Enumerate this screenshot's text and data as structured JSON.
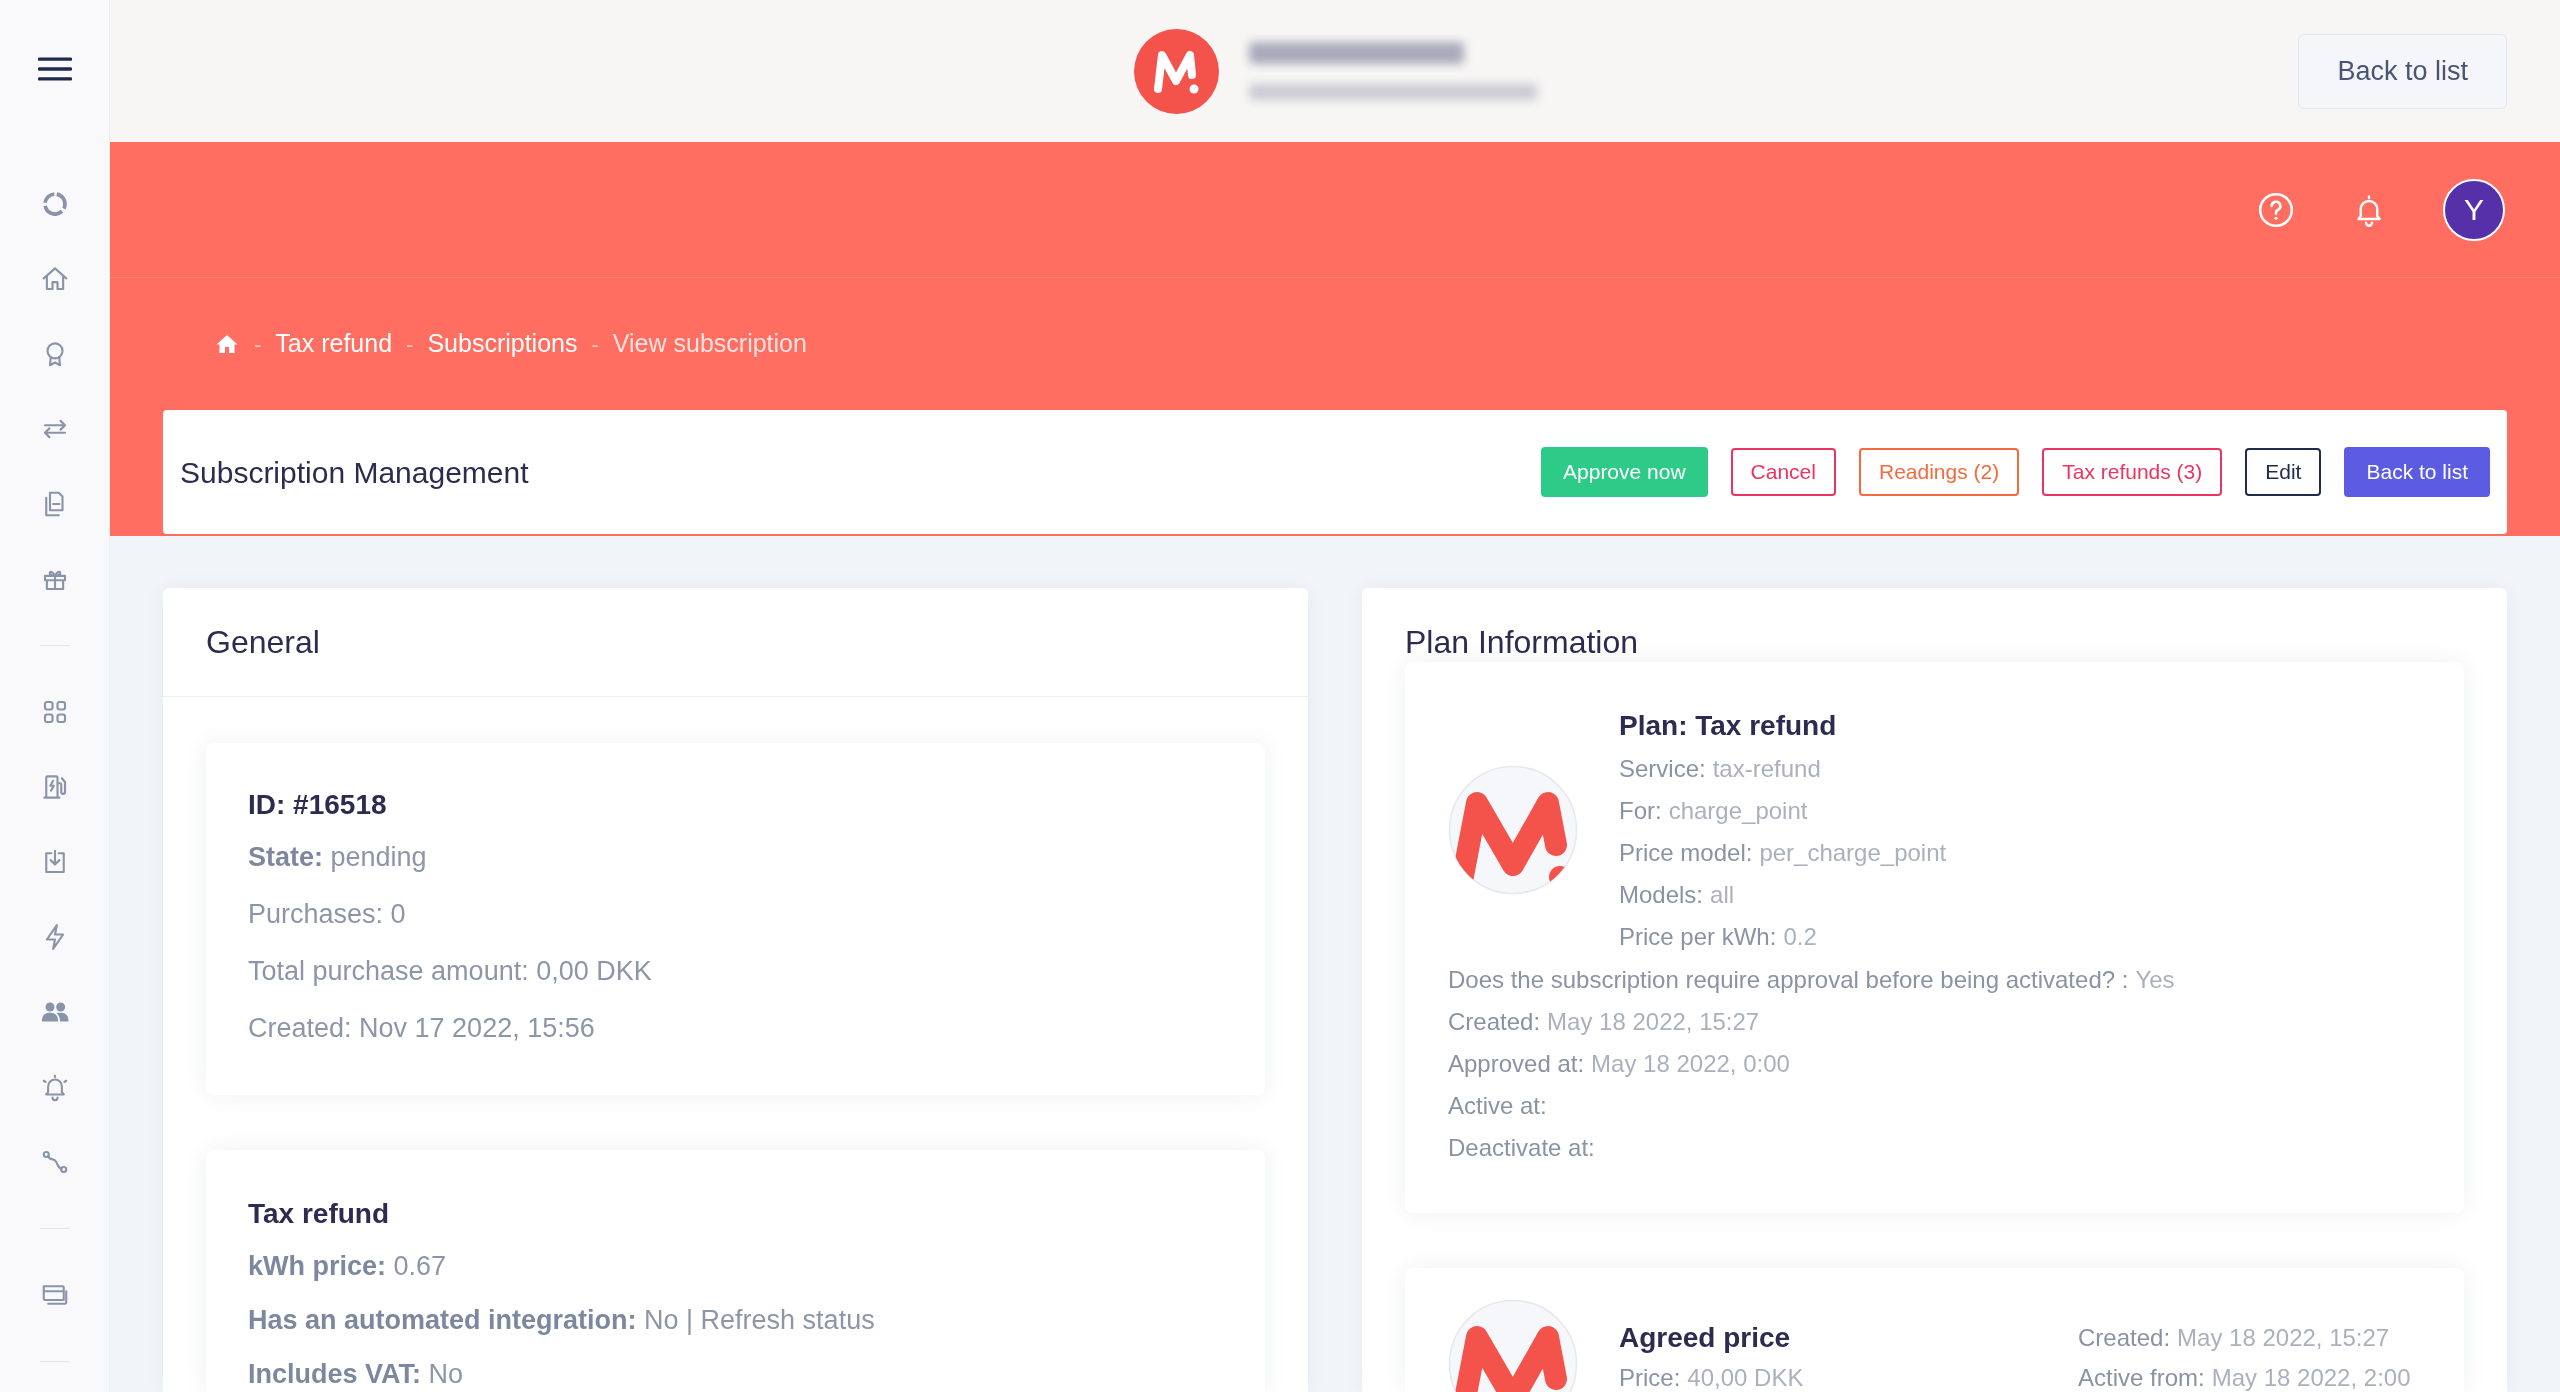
{
  "header": {
    "back_button": "Back to list"
  },
  "topbar": {
    "avatar": "Y"
  },
  "breadcrumb": {
    "items": [
      {
        "separator": "-",
        "label": "Tax refund",
        "current": false
      },
      {
        "separator": "-",
        "label": "Subscriptions",
        "current": false
      },
      {
        "separator": "-",
        "label": "View subscription",
        "current": true
      }
    ]
  },
  "page_header": {
    "title": "Subscription Management",
    "actions": [
      {
        "label": "Approve now",
        "kind": "solid",
        "color": "#2ecb88"
      },
      {
        "label": "Cancel",
        "kind": "outline",
        "color": "#ec3461"
      },
      {
        "label": "Readings (2)",
        "kind": "outline",
        "color": "#f56a3c"
      },
      {
        "label": "Tax refunds (3)",
        "kind": "outline",
        "color": "#ec3461"
      },
      {
        "label": "Edit",
        "kind": "outline",
        "color": "#1f2a4d"
      },
      {
        "label": "Back to list",
        "kind": "solid",
        "color": "#5b5ce2"
      }
    ]
  },
  "general": {
    "title": "General",
    "sections": [
      {
        "title": "ID: #16518",
        "lines": [
          "**State:** pending",
          "Purchases: 0",
          "Total purchase amount: 0,00 DKK",
          "Created: Nov 17 2022, 15:56"
        ]
      },
      {
        "title": "Tax refund",
        "lines": [
          "**kWh price:** 0.67",
          "**Has an automated integration:** No | Refresh status",
          "**Includes VAT:** No"
        ]
      }
    ]
  },
  "plan_information": {
    "title": "Plan Information",
    "plan": {
      "title": "Plan: Tax refund",
      "details": [
        {
          "label": "Service:",
          "value": "tax-refund"
        },
        {
          "label": "For:",
          "value": "charge_point"
        },
        {
          "label": "Price model:",
          "value": "per_charge_point"
        },
        {
          "label": "Models:",
          "value": "all"
        },
        {
          "label": "Price per kWh:",
          "value": "0.2"
        }
      ],
      "more": [
        {
          "label": "Does the subscription require approval before being activated? :",
          "value": "Yes"
        },
        {
          "label": "Created:",
          "value": "May 18 2022, 15:27"
        },
        {
          "label": "Approved at:",
          "value": "May 18 2022, 0:00"
        },
        {
          "label": "Active at:"
        },
        {
          "label": "Deactivate at:"
        }
      ]
    },
    "agreed_price": {
      "title": "Agreed price",
      "details": [
        {
          "label": "Price:",
          "value": "40,00 DKK"
        }
      ],
      "dates": [
        {
          "label": "Created:",
          "value": "May 18 2022, 15:27"
        },
        {
          "label": "Active from:",
          "value": "May 18 2022, 2:00"
        }
      ]
    }
  }
}
